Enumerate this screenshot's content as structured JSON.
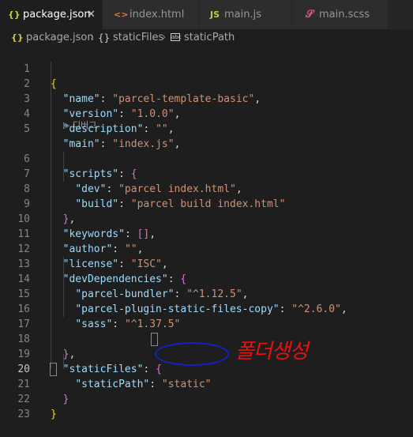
{
  "tabs": [
    {
      "label": "package.json",
      "icon": "{}",
      "icon_color": "#cbcb41",
      "active": true,
      "close": "✕"
    },
    {
      "label": "index.html",
      "icon": "<>",
      "icon_color": "#e37933",
      "active": false
    },
    {
      "label": "main.js",
      "icon": "JS",
      "icon_color": "#cbcb41",
      "active": false
    },
    {
      "label": "main.scss",
      "icon": "𝒮",
      "icon_color": "#f55385",
      "active": false
    }
  ],
  "breadcrumb": {
    "file_icon": "{}",
    "file": "package.json",
    "sep1": "›",
    "obj_icon": "{}",
    "node1": "staticFiles",
    "sep2": "›",
    "str_icon": "abc",
    "node2": "staticPath"
  },
  "editor": {
    "line_numbers": [
      "1",
      "2",
      "3",
      "4",
      "5",
      "6",
      "7",
      "8",
      "9",
      "10",
      "11",
      "12",
      "13",
      "14",
      "15",
      "16",
      "17",
      "18",
      "19",
      "20",
      "21",
      "22",
      "23"
    ],
    "current_line": "20",
    "codelens": "▷ 디버그"
  },
  "annotation": {
    "text": "폴더생성",
    "ellipse_color": "#1420c8",
    "text_color": "#e81010"
  }
}
